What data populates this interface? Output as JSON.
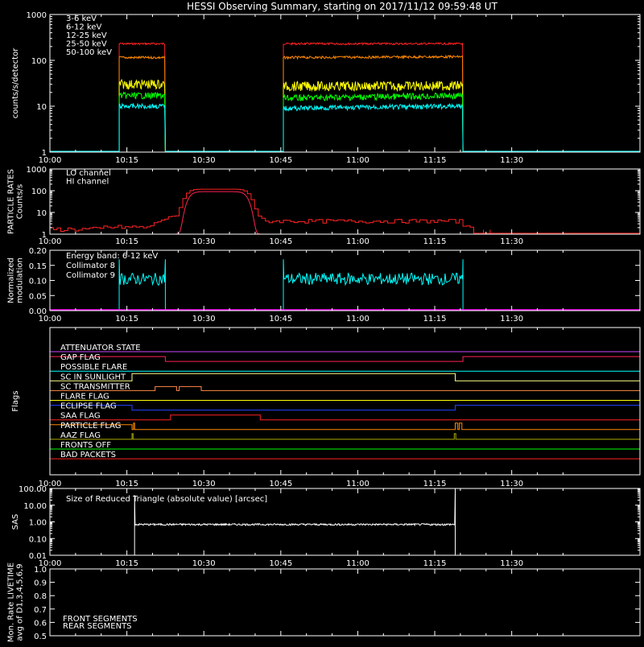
{
  "title": "HESSI Observing Summary, starting on 2017/11/12 09:59:48 UT",
  "time_axis": {
    "labels": [
      "10:00",
      "10:15",
      "10:30",
      "10:45",
      "11:00",
      "11:15",
      "11:30"
    ],
    "start_min": 0,
    "end_min": 115,
    "tick_minutes": [
      0,
      15,
      30,
      45,
      60,
      75,
      90
    ]
  },
  "colors": {
    "e1": "#ff2222",
    "e2": "#ff8800",
    "e3": "#ffff00",
    "e4": "#00ff00",
    "e5": "#00ffff",
    "lo": "#ff2222",
    "hi": "#ff2255",
    "c8": "#00ffff",
    "c9": "#ff00ff",
    "front": "#00ff00",
    "rear": "#33aa33"
  },
  "chart_data": [
    {
      "type": "line",
      "ylabel": "counts/s/detector",
      "yscale": "log",
      "ylim": [
        1,
        1000
      ],
      "yticks": [
        "1",
        "10",
        "100",
        "1000"
      ],
      "x_units": "minutes after 10:00",
      "series": [
        {
          "name": "3-6 keV",
          "color_key": "e1",
          "segments": [
            {
              "x": [
                13.5,
                22.5
              ],
              "y": [
                230,
                230
              ]
            },
            {
              "x": [
                45.5,
                80.5
              ],
              "y": [
                230,
                230
              ]
            }
          ],
          "base": 1
        },
        {
          "name": "6-12 keV",
          "color_key": "e2",
          "segments": [
            {
              "x": [
                13.5,
                22.5
              ],
              "y": [
                115,
                115
              ]
            },
            {
              "x": [
                45.5,
                80.5
              ],
              "y": [
                115,
                120
              ]
            }
          ],
          "base": 1
        },
        {
          "name": "12-25 keV",
          "color_key": "e3",
          "segments": [
            {
              "x": [
                13.5,
                22.5
              ],
              "y": [
                30,
                30
              ]
            },
            {
              "x": [
                45.5,
                80.5
              ],
              "y": [
                27,
                28
              ]
            }
          ],
          "base": 1
        },
        {
          "name": "25-50 keV",
          "color_key": "e4",
          "segments": [
            {
              "x": [
                13.5,
                22.5
              ],
              "y": [
                17,
                17
              ]
            },
            {
              "x": [
                45.5,
                80.5
              ],
              "y": [
                15,
                17
              ]
            }
          ],
          "base": 1
        },
        {
          "name": "50-100 keV",
          "color_key": "e5",
          "segments": [
            {
              "x": [
                13.5,
                22.5
              ],
              "y": [
                10,
                10
              ]
            },
            {
              "x": [
                45.5,
                80.5
              ],
              "y": [
                9,
                10
              ]
            }
          ],
          "base": 1
        }
      ]
    },
    {
      "type": "line",
      "ylabel": "PARTICLE RATES Counts/s",
      "ylines": [
        "PARTICLE RATES",
        "Counts/s"
      ],
      "yscale": "log",
      "ylim": [
        1,
        1000
      ],
      "yticks": [
        "1",
        "10",
        "100",
        "1000"
      ],
      "series": [
        {
          "name": "LO channel",
          "color_key": "lo"
        },
        {
          "name": "HI channel",
          "color_key": "hi"
        }
      ]
    },
    {
      "type": "line",
      "ylabel": "Normalized modulation",
      "ylines": [
        "Normalized",
        "modulation"
      ],
      "ylim": [
        0,
        0.2
      ],
      "yticks": [
        "0.00",
        "0.05",
        "0.10",
        "0.15",
        "0.20"
      ],
      "annotation": "Energy band: 6-12 keV",
      "series": [
        {
          "name": "Collimator 8",
          "color_key": "c8",
          "segments": [
            {
              "x": [
                13.5,
                22.5
              ],
              "y": 0.105
            },
            {
              "x": [
                45.5,
                80.5
              ],
              "y": 0.105
            }
          ]
        },
        {
          "name": "Collimator 9",
          "color_key": "c9",
          "value": 0.0
        }
      ]
    },
    {
      "type": "flags",
      "ylabel": "Flags",
      "flags": [
        {
          "name": "ATTENUATOR STATE",
          "color": "#cc44ff"
        },
        {
          "name": "GAP FLAG",
          "color": "#ff2255"
        },
        {
          "name": "POSSIBLE FLARE",
          "color": "#00ffff"
        },
        {
          "name": "SC IN SUNLIGHT",
          "color": "#ffff88"
        },
        {
          "name": "SC TRANSMITTER",
          "color": "#ff8844"
        },
        {
          "name": "FLARE FLAG",
          "color": "#ffff00"
        },
        {
          "name": "ECLIPSE FLAG",
          "color": "#2244ff"
        },
        {
          "name": "SAA FLAG",
          "color": "#ff2222"
        },
        {
          "name": "PARTICLE FLAG",
          "color": "#ff8800"
        },
        {
          "name": "AAZ FLAG",
          "color": "#aaaa00"
        },
        {
          "name": "FRONTS OFF",
          "color": "#00ff00"
        },
        {
          "name": "BAD PACKETS",
          "color": "#ff2222"
        }
      ]
    },
    {
      "type": "line",
      "ylabel": "SAS",
      "yscale": "log",
      "ylim": [
        0.01,
        100
      ],
      "yticks": [
        "0.01",
        "0.10",
        "1.00",
        "10.00",
        "100.00"
      ],
      "annotation": "Size of Reduced Triangle (absolute value) [arcsec]",
      "series": [
        {
          "color": "#ffffff",
          "x": [
            16.5,
            79
          ],
          "y": 0.7
        }
      ]
    },
    {
      "type": "line",
      "ylabel": "Mon. Rate LIVETIME avg of D1,3,4,5,6,9",
      "ylines": [
        "Mon. Rate LIVETIME",
        "avg of D1,3,4,5,6,9"
      ],
      "ylim": [
        0.5,
        1.0
      ],
      "yticks": [
        "0.5",
        "0.6",
        "0.7",
        "0.8",
        "0.9",
        "1.0"
      ],
      "series": [
        {
          "name": "FRONT SEGMENTS",
          "color_key": "front"
        },
        {
          "name": "REAR SEGMENTS",
          "color_key": "rear"
        }
      ]
    }
  ]
}
